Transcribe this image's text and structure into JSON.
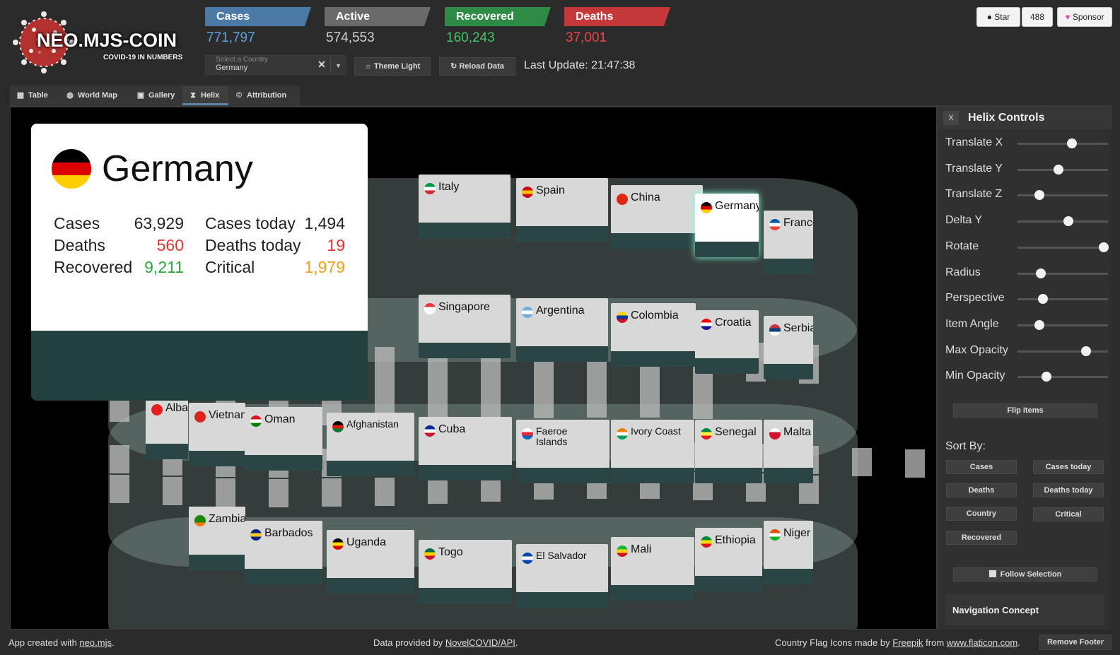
{
  "header": {
    "logo_title": "NEO.MJS-COIN",
    "logo_subtitle": "COVID-19 IN NUMBERS",
    "stats": {
      "cases": {
        "label": "Cases",
        "value": "771,797",
        "color": "#4c7aa6"
      },
      "active": {
        "label": "Active",
        "value": "574,553",
        "color": "#6a6a6a"
      },
      "recovered": {
        "label": "Recovered",
        "value": "160,243",
        "color": "#2e8b45"
      },
      "deaths": {
        "label": "Deaths",
        "value": "37,001",
        "color": "#c4383a"
      }
    },
    "country_select": {
      "label": "Select a Country",
      "value": "Germany"
    },
    "theme_button": "Theme Light",
    "reload_button": "Reload Data",
    "last_update": "Last Update: 21:47:38",
    "github": {
      "star": "Star",
      "count": "488",
      "sponsor": "Sponsor"
    }
  },
  "tabs": [
    {
      "label": "Table",
      "icon": "table-icon"
    },
    {
      "label": "World Map",
      "icon": "globe-icon"
    },
    {
      "label": "Gallery",
      "icon": "images-icon"
    },
    {
      "label": "Helix",
      "icon": "hourglass-icon",
      "active": true
    },
    {
      "label": "Attribution",
      "icon": "copyright-icon"
    }
  ],
  "detail": {
    "country": "Germany",
    "cases_label": "Cases",
    "cases": "63,929",
    "deaths_label": "Deaths",
    "deaths": "560",
    "recovered_label": "Recovered",
    "recovered": "9,211",
    "cases_today_label": "Cases today",
    "cases_today": "1,494",
    "deaths_today_label": "Deaths today",
    "deaths_today": "19",
    "critical_label": "Critical",
    "critical": "1,979"
  },
  "helix_cards": [
    {
      "name": "Italy",
      "flag": [
        "#009246",
        "#ffffff",
        "#ce2b37"
      ]
    },
    {
      "name": "Spain",
      "flag": [
        "#c60b1e",
        "#ffc400",
        "#c60b1e"
      ]
    },
    {
      "name": "China",
      "flag": [
        "#de2910",
        "#de2910",
        "#de2910"
      ]
    },
    {
      "name": "Germany",
      "flag": [
        "#000000",
        "#dd0000",
        "#ffce00"
      ]
    },
    {
      "name": "France",
      "flag": [
        "#0055a4",
        "#ffffff",
        "#ef4135"
      ]
    },
    {
      "name": "Singapore",
      "flag": [
        "#ef3340",
        "#ffffff",
        "#ffffff"
      ]
    },
    {
      "name": "Argentina",
      "flag": [
        "#74acdf",
        "#ffffff",
        "#74acdf"
      ]
    },
    {
      "name": "Colombia",
      "flag": [
        "#fcd116",
        "#003893",
        "#ce1126"
      ]
    },
    {
      "name": "Croatia",
      "flag": [
        "#ff0000",
        "#ffffff",
        "#171796"
      ]
    },
    {
      "name": "Serbia",
      "flag": [
        "#c6363c",
        "#0c4076",
        "#ffffff"
      ]
    },
    {
      "name": "Albania",
      "flag": [
        "#e41e20",
        "#e41e20",
        "#e41e20"
      ]
    },
    {
      "name": "Vietnam",
      "flag": [
        "#da251d",
        "#da251d",
        "#da251d"
      ]
    },
    {
      "name": "Oman",
      "flag": [
        "#db161b",
        "#ffffff",
        "#008000"
      ]
    },
    {
      "name": "Afghanistan",
      "flag": [
        "#000000",
        "#d32011",
        "#007a36"
      ]
    },
    {
      "name": "Cuba",
      "flag": [
        "#002a8f",
        "#ffffff",
        "#cf142b"
      ]
    },
    {
      "name": "Faeroe Islands",
      "flag": [
        "#ffffff",
        "#ed2939",
        "#0065bd"
      ]
    },
    {
      "name": "Ivory Coast",
      "flag": [
        "#f77f00",
        "#ffffff",
        "#009e60"
      ]
    },
    {
      "name": "Senegal",
      "flag": [
        "#00853f",
        "#fdef42",
        "#e31b23"
      ]
    },
    {
      "name": "Malta",
      "flag": [
        "#ffffff",
        "#cf142b",
        "#cf142b"
      ]
    },
    {
      "name": "Zambia",
      "flag": [
        "#198a00",
        "#198a00",
        "#ef7d00"
      ]
    },
    {
      "name": "Barbados",
      "flag": [
        "#00267f",
        "#ffc726",
        "#00267f"
      ]
    },
    {
      "name": "Uganda",
      "flag": [
        "#000000",
        "#fcdc04",
        "#d90000"
      ]
    },
    {
      "name": "Togo",
      "flag": [
        "#006a4e",
        "#ffce00",
        "#d21034"
      ]
    },
    {
      "name": "El Salvador",
      "flag": [
        "#0047ab",
        "#ffffff",
        "#0047ab"
      ]
    },
    {
      "name": "Mali",
      "flag": [
        "#14b53a",
        "#fcd116",
        "#ce1126"
      ]
    },
    {
      "name": "Ethiopia",
      "flag": [
        "#078930",
        "#fcdd09",
        "#da121a"
      ]
    },
    {
      "name": "Niger",
      "flag": [
        "#e05206",
        "#ffffff",
        "#0db02b"
      ]
    }
  ],
  "controls": {
    "title": "Helix Controls",
    "close": "X",
    "sliders": [
      {
        "label": "Translate X",
        "value": 0.6
      },
      {
        "label": "Translate Y",
        "value": 0.45
      },
      {
        "label": "Translate Z",
        "value": 0.24
      },
      {
        "label": "Delta Y",
        "value": 0.56
      },
      {
        "label": "Rotate",
        "value": 0.95
      },
      {
        "label": "Radius",
        "value": 0.26
      },
      {
        "label": "Perspective",
        "value": 0.28
      },
      {
        "label": "Item Angle",
        "value": 0.24
      },
      {
        "label": "Max Opacity",
        "value": 0.76
      },
      {
        "label": "Min Opacity",
        "value": 0.32
      }
    ],
    "flip_items": "Flip Items",
    "sort_by": "Sort By:",
    "sort_buttons": [
      "Cases",
      "Cases today",
      "Deaths",
      "Deaths today",
      "Country",
      "Critical",
      "Recovered"
    ],
    "follow_selection": "Follow Selection",
    "navigation_concept": "Navigation Concept"
  },
  "footer": {
    "created_prefix": "App created with ",
    "created_link": "neo.mjs",
    "data_prefix": "Data provided by ",
    "data_link": "NovelCOVID/API",
    "flags_prefix": "Country Flag Icons made by ",
    "flags_link1": "Freepik",
    "flags_mid": " from ",
    "flags_link2": "www.flaticon.com",
    "remove": "Remove Footer"
  }
}
